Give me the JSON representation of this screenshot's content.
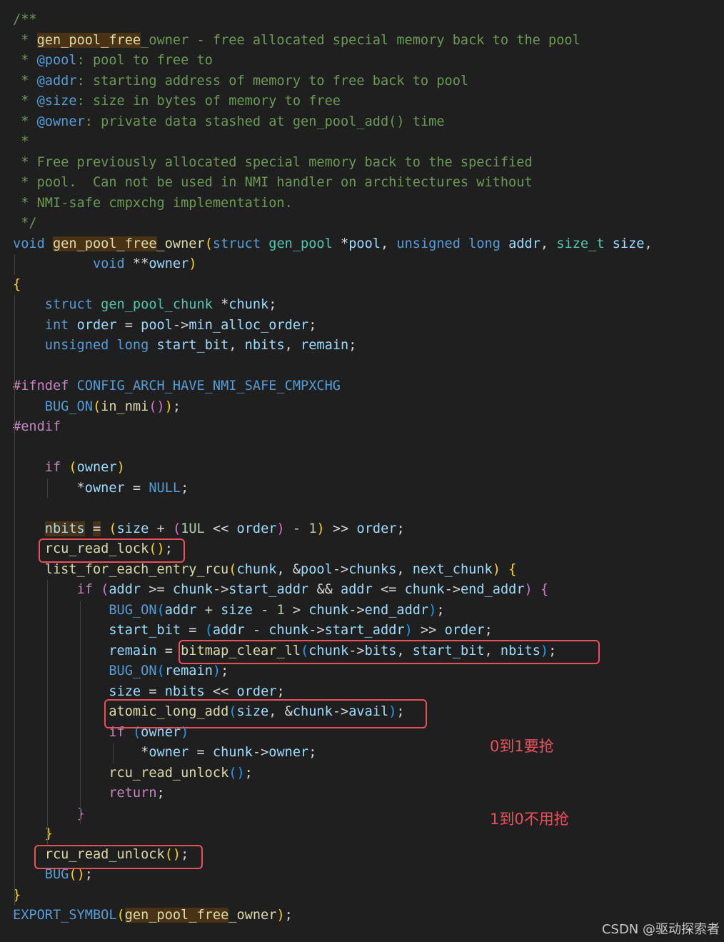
{
  "editor": {
    "colors": {
      "background": "#1f1f1f",
      "comment": "#6a9955",
      "keyword": "#569cd6",
      "control": "#c586c0",
      "type": "#4ec9b0",
      "function": "#dcdcaa",
      "variable": "#9cdcfe",
      "macro": "#569cd6",
      "number": "#b5cea8",
      "plain": "#d4d4d4",
      "brace": "#ffd700",
      "paren2": "#da70d6",
      "paren3": "#179fff",
      "annotation": "#e8505b"
    },
    "lines": [
      [
        [
          "c",
          "/**"
        ]
      ],
      [
        [
          "c",
          " * "
        ],
        [
          "fhl",
          "gen_pool_free"
        ],
        [
          "c",
          "_owner - free allocated special memory back to the pool"
        ]
      ],
      [
        [
          "c",
          " * "
        ],
        [
          "ck",
          "@pool"
        ],
        [
          "c",
          ": pool to free to"
        ]
      ],
      [
        [
          "c",
          " * "
        ],
        [
          "ck",
          "@addr"
        ],
        [
          "c",
          ": starting address of memory to free back to pool"
        ]
      ],
      [
        [
          "c",
          " * "
        ],
        [
          "ck",
          "@size"
        ],
        [
          "c",
          ": size in bytes of memory to free"
        ]
      ],
      [
        [
          "c",
          " * "
        ],
        [
          "ck",
          "@owner"
        ],
        [
          "c",
          ": private data stashed at gen_pool_add() time"
        ]
      ],
      [
        [
          "c",
          " *"
        ]
      ],
      [
        [
          "c",
          " * Free previously allocated special memory back to the specified"
        ]
      ],
      [
        [
          "c",
          " * pool.  Can not be used in NMI handler on architectures without"
        ]
      ],
      [
        [
          "c",
          " * NMI-safe cmpxchg implementation."
        ]
      ],
      [
        [
          "c",
          " */"
        ]
      ],
      [
        [
          "k",
          "void"
        ],
        [
          "p",
          " "
        ],
        [
          "fhl",
          "gen_pool_free"
        ],
        [
          "f",
          "_owner"
        ],
        [
          "b",
          "("
        ],
        [
          "k",
          "struct"
        ],
        [
          "p",
          " "
        ],
        [
          "t",
          "gen_pool"
        ],
        [
          "p",
          " *"
        ],
        [
          "v",
          "pool"
        ],
        [
          "p",
          ", "
        ],
        [
          "k",
          "unsigned"
        ],
        [
          "p",
          " "
        ],
        [
          "k",
          "long"
        ],
        [
          "p",
          " "
        ],
        [
          "v",
          "addr"
        ],
        [
          "p",
          ", "
        ],
        [
          "t",
          "size_t"
        ],
        [
          "p",
          " "
        ],
        [
          "v",
          "size"
        ],
        [
          "p",
          ","
        ]
      ],
      [
        [
          "p",
          "          "
        ],
        [
          "k",
          "void"
        ],
        [
          "p",
          " **"
        ],
        [
          "v",
          "owner"
        ],
        [
          "b",
          ")"
        ]
      ],
      [
        [
          "y",
          "{"
        ]
      ],
      [
        [
          "p",
          "    "
        ],
        [
          "k",
          "struct"
        ],
        [
          "p",
          " "
        ],
        [
          "t",
          "gen_pool_chunk"
        ],
        [
          "p",
          " *"
        ],
        [
          "v",
          "chunk"
        ],
        [
          "p",
          ";"
        ]
      ],
      [
        [
          "p",
          "    "
        ],
        [
          "k",
          "int"
        ],
        [
          "p",
          " "
        ],
        [
          "v",
          "order"
        ],
        [
          "p",
          " = "
        ],
        [
          "v",
          "pool"
        ],
        [
          "p",
          "->"
        ],
        [
          "v",
          "min_alloc_order"
        ],
        [
          "p",
          ";"
        ]
      ],
      [
        [
          "p",
          "    "
        ],
        [
          "k",
          "unsigned"
        ],
        [
          "p",
          " "
        ],
        [
          "k",
          "long"
        ],
        [
          "p",
          " "
        ],
        [
          "v",
          "start_bit"
        ],
        [
          "p",
          ", "
        ],
        [
          "v",
          "nbits"
        ],
        [
          "p",
          ", "
        ],
        [
          "v",
          "remain"
        ],
        [
          "p",
          ";"
        ]
      ],
      [],
      [
        [
          "m",
          "#ifndef"
        ],
        [
          "p",
          " "
        ],
        [
          "k",
          "CONFIG_ARCH_HAVE_NMI_SAFE_CMPXCHG"
        ]
      ],
      [
        [
          "p",
          "    "
        ],
        [
          "k",
          "BUG_ON"
        ],
        [
          "b",
          "("
        ],
        [
          "f",
          "in_nmi"
        ],
        [
          "d",
          "()"
        ],
        [
          "b",
          ")"
        ],
        [
          "p",
          ";"
        ]
      ],
      [
        [
          "m",
          "#endif"
        ]
      ],
      [],
      [
        [
          "p",
          "    "
        ],
        [
          "m",
          "if"
        ],
        [
          "p",
          " "
        ],
        [
          "b",
          "("
        ],
        [
          "v",
          "owner"
        ],
        [
          "b",
          ")"
        ]
      ],
      [
        [
          "p",
          "        *"
        ],
        [
          "v",
          "owner"
        ],
        [
          "p",
          " = "
        ],
        [
          "k",
          "NULL"
        ],
        [
          "p",
          ";"
        ]
      ],
      [],
      [
        [
          "p",
          "    "
        ],
        [
          "vhl",
          "nbits"
        ],
        [
          "p",
          " "
        ],
        [
          "phl",
          "="
        ],
        [
          "p",
          " "
        ],
        [
          "b",
          "("
        ],
        [
          "v",
          "size"
        ],
        [
          "p",
          " + "
        ],
        [
          "d",
          "("
        ],
        [
          "n",
          "1UL"
        ],
        [
          "p",
          " << "
        ],
        [
          "v",
          "order"
        ],
        [
          "d",
          ")"
        ],
        [
          "p",
          " - "
        ],
        [
          "n",
          "1"
        ],
        [
          "b",
          ")"
        ],
        [
          "p",
          " >> "
        ],
        [
          "v",
          "order"
        ],
        [
          "p",
          ";"
        ]
      ],
      [
        [
          "p",
          "    "
        ],
        [
          "f",
          "rcu_read_lock"
        ],
        [
          "b",
          "()"
        ],
        [
          "p",
          ";"
        ]
      ],
      [
        [
          "p",
          "    "
        ],
        [
          "f",
          "list_for_each_entry_rcu"
        ],
        [
          "b",
          "("
        ],
        [
          "v",
          "chunk"
        ],
        [
          "p",
          ", &"
        ],
        [
          "v",
          "pool"
        ],
        [
          "p",
          "->"
        ],
        [
          "v",
          "chunks"
        ],
        [
          "p",
          ", "
        ],
        [
          "v",
          "next_chunk"
        ],
        [
          "b",
          ")"
        ],
        [
          "p",
          " "
        ],
        [
          "b",
          "{"
        ]
      ],
      [
        [
          "p",
          "        "
        ],
        [
          "m",
          "if"
        ],
        [
          "p",
          " "
        ],
        [
          "d",
          "("
        ],
        [
          "v",
          "addr"
        ],
        [
          "p",
          " >= "
        ],
        [
          "v",
          "chunk"
        ],
        [
          "p",
          "->"
        ],
        [
          "v",
          "start_addr"
        ],
        [
          "p",
          " && "
        ],
        [
          "v",
          "addr"
        ],
        [
          "p",
          " <= "
        ],
        [
          "v",
          "chunk"
        ],
        [
          "p",
          "->"
        ],
        [
          "v",
          "end_addr"
        ],
        [
          "d",
          ")"
        ],
        [
          "p",
          " "
        ],
        [
          "d",
          "{"
        ]
      ],
      [
        [
          "p",
          "            "
        ],
        [
          "k",
          "BUG_ON"
        ],
        [
          "e",
          "("
        ],
        [
          "v",
          "addr"
        ],
        [
          "p",
          " + "
        ],
        [
          "v",
          "size"
        ],
        [
          "p",
          " - "
        ],
        [
          "n",
          "1"
        ],
        [
          "p",
          " > "
        ],
        [
          "v",
          "chunk"
        ],
        [
          "p",
          "->"
        ],
        [
          "v",
          "end_addr"
        ],
        [
          "e",
          ")"
        ],
        [
          "p",
          ";"
        ]
      ],
      [
        [
          "p",
          "            "
        ],
        [
          "v",
          "start_bit"
        ],
        [
          "p",
          " = "
        ],
        [
          "e",
          "("
        ],
        [
          "v",
          "addr"
        ],
        [
          "p",
          " - "
        ],
        [
          "v",
          "chunk"
        ],
        [
          "p",
          "->"
        ],
        [
          "v",
          "start_addr"
        ],
        [
          "e",
          ")"
        ],
        [
          "p",
          " >> "
        ],
        [
          "v",
          "order"
        ],
        [
          "p",
          ";"
        ]
      ],
      [
        [
          "p",
          "            "
        ],
        [
          "v",
          "remain"
        ],
        [
          "p",
          " = "
        ],
        [
          "f",
          "bitmap_clear_ll"
        ],
        [
          "e",
          "("
        ],
        [
          "v",
          "chunk"
        ],
        [
          "p",
          "->"
        ],
        [
          "v",
          "bits"
        ],
        [
          "p",
          ", "
        ],
        [
          "v",
          "start_bit"
        ],
        [
          "p",
          ", "
        ],
        [
          "v",
          "nbits"
        ],
        [
          "e",
          ")"
        ],
        [
          "p",
          ";"
        ]
      ],
      [
        [
          "p",
          "            "
        ],
        [
          "k",
          "BUG_ON"
        ],
        [
          "e",
          "("
        ],
        [
          "v",
          "remain"
        ],
        [
          "e",
          ")"
        ],
        [
          "p",
          ";"
        ]
      ],
      [
        [
          "p",
          "            "
        ],
        [
          "v",
          "size"
        ],
        [
          "p",
          " = "
        ],
        [
          "v",
          "nbits"
        ],
        [
          "p",
          " << "
        ],
        [
          "v",
          "order"
        ],
        [
          "p",
          ";"
        ]
      ],
      [
        [
          "p",
          "            "
        ],
        [
          "f",
          "atomic_long_add"
        ],
        [
          "e",
          "("
        ],
        [
          "v",
          "size"
        ],
        [
          "p",
          ", &"
        ],
        [
          "v",
          "chunk"
        ],
        [
          "p",
          "->"
        ],
        [
          "v",
          "avail"
        ],
        [
          "e",
          ")"
        ],
        [
          "p",
          ";"
        ]
      ],
      [
        [
          "p",
          "            "
        ],
        [
          "m",
          "if"
        ],
        [
          "p",
          " "
        ],
        [
          "e",
          "("
        ],
        [
          "v",
          "owner"
        ],
        [
          "e",
          ")"
        ]
      ],
      [
        [
          "p",
          "                *"
        ],
        [
          "v",
          "owner"
        ],
        [
          "p",
          " = "
        ],
        [
          "v",
          "chunk"
        ],
        [
          "p",
          "->"
        ],
        [
          "v",
          "owner"
        ],
        [
          "p",
          ";"
        ]
      ],
      [
        [
          "p",
          "            "
        ],
        [
          "f",
          "rcu_read_unlock"
        ],
        [
          "e",
          "()"
        ],
        [
          "p",
          ";"
        ]
      ],
      [
        [
          "p",
          "            "
        ],
        [
          "m",
          "return"
        ],
        [
          "p",
          ";"
        ]
      ],
      [
        [
          "p",
          "        "
        ],
        [
          "d",
          "}"
        ]
      ],
      [
        [
          "p",
          "    "
        ],
        [
          "b",
          "}"
        ]
      ],
      [
        [
          "p",
          "    "
        ],
        [
          "f",
          "rcu_read_unlock"
        ],
        [
          "b",
          "()"
        ],
        [
          "p",
          ";"
        ]
      ],
      [
        [
          "p",
          "    "
        ],
        [
          "k",
          "BUG"
        ],
        [
          "b",
          "()"
        ],
        [
          "p",
          ";"
        ]
      ],
      [
        [
          "y",
          "}"
        ]
      ],
      [
        [
          "k",
          "EXPORT_SYMBOL"
        ],
        [
          "b",
          "("
        ],
        [
          "fhl",
          "gen_pool_free"
        ],
        [
          "f",
          "_owner"
        ],
        [
          "b",
          ")"
        ],
        [
          "p",
          ";"
        ]
      ]
    ]
  },
  "annotations": {
    "note_line1": "0到1要抢",
    "note_line2": "1到0不用抢"
  },
  "watermark": "CSDN @驱动探索者"
}
